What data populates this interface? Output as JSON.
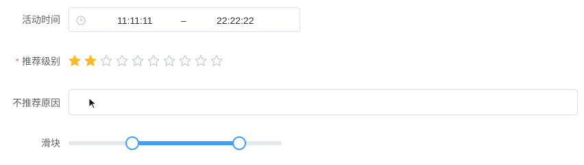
{
  "form": {
    "activity_time": {
      "label": "活动时间",
      "icon": "clock-icon",
      "start": "11:11:11",
      "separator": "–",
      "end": "22:22:22"
    },
    "recommend_level": {
      "label": "推荐级别",
      "required_mark": "*",
      "rating_value": 2,
      "rating_max": 10,
      "active_color": "#f7ba2a",
      "inactive_color": "#c0c4cc"
    },
    "not_recommended_reason": {
      "label": "不推荐原因",
      "value": ""
    },
    "slider": {
      "label": "滑块",
      "min": 0,
      "max": 100,
      "range": [
        30,
        80
      ],
      "color": "#409eff"
    }
  }
}
